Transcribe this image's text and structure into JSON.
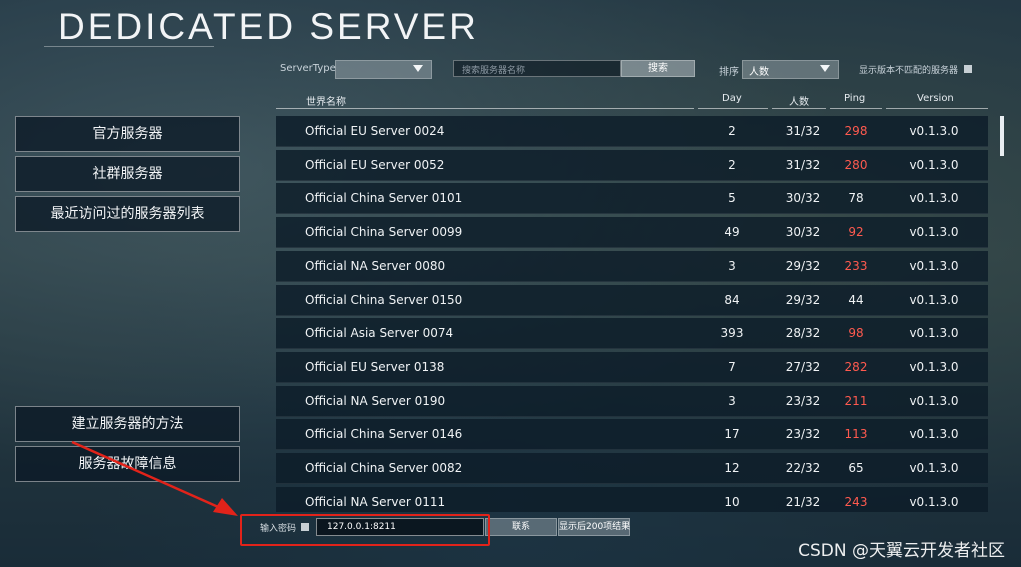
{
  "title": "DEDICATED SERVER",
  "toolbar": {
    "server_type_label": "ServerType",
    "server_type_value": "",
    "search_placeholder": "搜索服务器名称",
    "search_button": "搜索",
    "sort_label": "排序",
    "sort_value": "人数",
    "show_mismatch_label": "显示版本不匹配的服务器"
  },
  "columns": {
    "name": "世界名称",
    "day": "Day",
    "players": "人数",
    "ping": "Ping",
    "version": "Version"
  },
  "sidebar": {
    "official": "官方服务器",
    "community": "社群服务器",
    "recent": "最近访问过的服务器列表",
    "how_to": "建立服务器的方法",
    "troubleshoot": "服务器故障信息"
  },
  "servers": [
    {
      "name": "Official EU Server 0024",
      "day": "2",
      "players": "31/32",
      "ping": "298",
      "ping_high": true,
      "version": "v0.1.3.0"
    },
    {
      "name": "Official EU Server 0052",
      "day": "2",
      "players": "31/32",
      "ping": "280",
      "ping_high": true,
      "version": "v0.1.3.0"
    },
    {
      "name": "Official China Server 0101",
      "day": "5",
      "players": "30/32",
      "ping": "78",
      "ping_high": false,
      "version": "v0.1.3.0"
    },
    {
      "name": "Official China Server 0099",
      "day": "49",
      "players": "30/32",
      "ping": "92",
      "ping_high": true,
      "version": "v0.1.3.0"
    },
    {
      "name": "Official NA Server 0080",
      "day": "3",
      "players": "29/32",
      "ping": "233",
      "ping_high": true,
      "version": "v0.1.3.0"
    },
    {
      "name": "Official China Server 0150",
      "day": "84",
      "players": "29/32",
      "ping": "44",
      "ping_high": false,
      "version": "v0.1.3.0"
    },
    {
      "name": "Official Asia Server 0074",
      "day": "393",
      "players": "28/32",
      "ping": "98",
      "ping_high": true,
      "version": "v0.1.3.0"
    },
    {
      "name": "Official EU Server 0138",
      "day": "7",
      "players": "27/32",
      "ping": "282",
      "ping_high": true,
      "version": "v0.1.3.0"
    },
    {
      "name": "Official NA Server 0190",
      "day": "3",
      "players": "23/32",
      "ping": "211",
      "ping_high": true,
      "version": "v0.1.3.0"
    },
    {
      "name": "Official China Server 0146",
      "day": "17",
      "players": "23/32",
      "ping": "113",
      "ping_high": true,
      "version": "v0.1.3.0"
    },
    {
      "name": "Official China Server 0082",
      "day": "12",
      "players": "22/32",
      "ping": "65",
      "ping_high": false,
      "version": "v0.1.3.0"
    },
    {
      "name": "Official NA Server 0111",
      "day": "10",
      "players": "21/32",
      "ping": "243",
      "ping_high": true,
      "version": "v0.1.3.0"
    }
  ],
  "bottom": {
    "password_label": "输入密码",
    "address_value": "127.0.0.1:8211",
    "connect_button": "联系",
    "show_more_button": "显示后200项结果"
  },
  "colors": {
    "ping_high": "#ff5a4f",
    "annotation": "#e2231a"
  },
  "watermark": "CSDN @天翼云开发者社区"
}
